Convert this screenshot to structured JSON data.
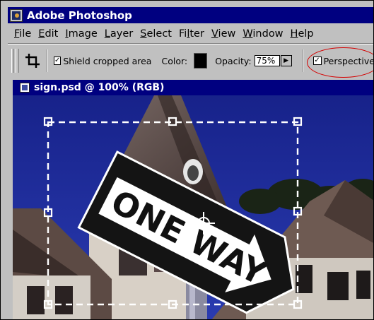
{
  "window": {
    "title": "Adobe Photoshop"
  },
  "menu": {
    "items": [
      {
        "ul": "F",
        "rest": "ile"
      },
      {
        "ul": "E",
        "rest": "dit"
      },
      {
        "ul": "I",
        "rest": "mage"
      },
      {
        "ul": "L",
        "rest": "ayer"
      },
      {
        "ul": "S",
        "rest": "elect"
      },
      {
        "pre": "Fi",
        "ul": "l",
        "rest": "ter"
      },
      {
        "ul": "V",
        "rest": "iew"
      },
      {
        "ul": "W",
        "rest": "indow"
      },
      {
        "ul": "H",
        "rest": "elp"
      }
    ]
  },
  "options": {
    "shield_checked": "✓",
    "shield_label": "Shield cropped area",
    "color_label": "Color:",
    "color_value": "#000000",
    "opacity_label": "Opacity:",
    "opacity_value": "75%",
    "opacity_arrow": "▶",
    "perspective_checked": "✓",
    "perspective_label": "Perspective",
    "highlight_color": "#d40000"
  },
  "document": {
    "title": "sign.psd @ 100% (RGB)",
    "sign_text": "ONE WAY"
  },
  "icons": {
    "app": "photoshop-app-icon",
    "crop": "crop-tool-icon",
    "doc": "document-icon",
    "center": "crop-center-icon"
  }
}
